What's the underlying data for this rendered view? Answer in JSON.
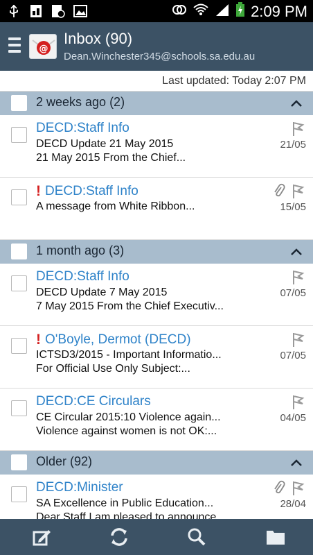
{
  "status_bar": {
    "time": "2:09 PM",
    "icons": [
      "usb-icon",
      "screenshot-icon",
      "document-icon",
      "gallery-icon",
      "nfc-icon",
      "wifi-icon",
      "signal-icon",
      "battery-charging-icon"
    ]
  },
  "header": {
    "title": "Inbox (90)",
    "account": "Dean.Winchester345@schools.sa.edu.au"
  },
  "last_updated": "Last updated:  Today 2:07 PM",
  "groups": [
    {
      "label": "2 weeks ago (2)",
      "emails": [
        {
          "sender": "DECD:Staff Info",
          "important": false,
          "attachment": false,
          "line1": "DECD Update 21 May 2015",
          "line2": "21 May 2015 From the Chief...",
          "date": "21/05"
        },
        {
          "sender": "DECD:Staff Info",
          "important": true,
          "attachment": true,
          "line1": "A message from White Ribbon...",
          "line2": "",
          "date": "15/05"
        }
      ]
    },
    {
      "label": "1 month ago (3)",
      "emails": [
        {
          "sender": "DECD:Staff Info",
          "important": false,
          "attachment": false,
          "line1": "DECD Update 7 May 2015",
          "line2": "7 May 2015 From the Chief Executiv...",
          "date": "07/05"
        },
        {
          "sender": "O'Boyle, Dermot (DECD)",
          "important": true,
          "attachment": false,
          "line1": "ICTSD3/2015 - Important Informatio...",
          "line2": "For Official Use Only Subject:...",
          "date": "07/05"
        },
        {
          "sender": "DECD:CE Circulars",
          "important": false,
          "attachment": false,
          "line1": "CE Circular 2015:10 Violence again...",
          "line2": "Violence against women is not OK:...",
          "date": "04/05"
        }
      ]
    },
    {
      "label": "Older (92)",
      "emails": [
        {
          "sender": "DECD:Minister",
          "important": false,
          "attachment": true,
          "line1": "SA Excellence in Public Education...",
          "line2": "Dear Staff I am pleased to announce",
          "date": "28/04"
        }
      ]
    }
  ],
  "important_mark": "!",
  "colors": {
    "header_bg": "#3c5265",
    "group_bg": "#a8bccd",
    "sender": "#2f83c9",
    "important": "#d41f1f"
  },
  "bottom_nav": [
    "compose-icon",
    "sync-icon",
    "search-icon",
    "folder-icon"
  ]
}
